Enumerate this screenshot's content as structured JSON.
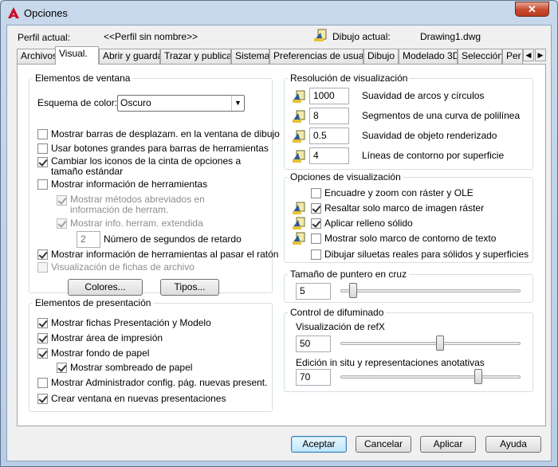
{
  "window": {
    "title": "Opciones",
    "close_label": "✕"
  },
  "header": {
    "profile_label": "Perfil actual:",
    "profile_value": "<<Perfil sin nombre>>",
    "drawing_label": "Dibujo actual:",
    "drawing_value": "Drawing1.dwg"
  },
  "tabs": [
    "Archivos",
    "Visual.",
    "Abrir y guardar",
    "Trazar y publicar",
    "Sistema",
    "Preferencias de usuario",
    "Dibujo",
    "Modelado 3D",
    "Selección",
    "Per"
  ],
  "active_tab": "Visual.",
  "window_elements": {
    "title": "Elementos de ventana",
    "scheme_label": "Esquema de color:",
    "scheme_value": "Oscuro",
    "scrollbars": "Mostrar barras de desplazam. en la ventana de dibujo",
    "big_buttons": "Usar botones grandes para barras de herramientas",
    "ribbon_icons": "Cambiar los iconos de la cinta de opciones a tamaño estándar",
    "tooltips": "Mostrar información de herramientas",
    "shortcut_keys": "Mostrar métodos abreviados en información de herram.",
    "extended_tooltips": "Mostrar info. herram. extendida",
    "delay_value": "2",
    "delay_label": "Número de segundos de retardo",
    "rollover": "Mostrar información de herramientas al pasar el ratón",
    "file_tabs": "Visualización de fichas de archivo",
    "colors_button": "Colores...",
    "fonts_button": "Tipos..."
  },
  "layout_elements": {
    "title": "Elementos de presentación",
    "layout_tabs": "Mostrar fichas Presentación y Modelo",
    "printable_area": "Mostrar área de impresión",
    "paper_bg": "Mostrar fondo de papel",
    "paper_shadow": "Mostrar sombreado de papel",
    "page_setup": "Mostrar Administrador config. pág. nuevas present.",
    "create_viewport": "Crear ventana en nuevas presentaciones"
  },
  "resolution": {
    "title": "Resolución de visualización",
    "rows": [
      {
        "value": "1000",
        "label": "Suavidad de arcos y círculos"
      },
      {
        "value": "8",
        "label": "Segmentos de una curva de polilínea"
      },
      {
        "value": "0.5",
        "label": "Suavidad de objeto renderizado"
      },
      {
        "value": "4",
        "label": "Líneas de contorno por superficie"
      }
    ]
  },
  "display_perf": {
    "title": "Opciones de visualización",
    "pan_zoom": "Encuadre y zoom con ráster y OLE",
    "highlight_raster": "Resaltar solo marco de imagen ráster",
    "solid_fill": "Aplicar relleno sólido",
    "text_frame": "Mostrar solo marco de contorno de texto",
    "silhouettes": "Dibujar siluetas reales para sólidos y superficies"
  },
  "crosshair": {
    "title": "Tamaño de puntero en cruz",
    "value": "5",
    "level": 5
  },
  "fade": {
    "title": "Control de difuminado",
    "xref_label": "Visualización de refX",
    "xref_value": "50",
    "xref_level": 50,
    "inplace_label": "Edición in situ y representaciones anotativas",
    "inplace_value": "70",
    "inplace_level": 70
  },
  "footer": {
    "ok": "Aceptar",
    "cancel": "Cancelar",
    "apply": "Aplicar",
    "help": "Ayuda"
  }
}
